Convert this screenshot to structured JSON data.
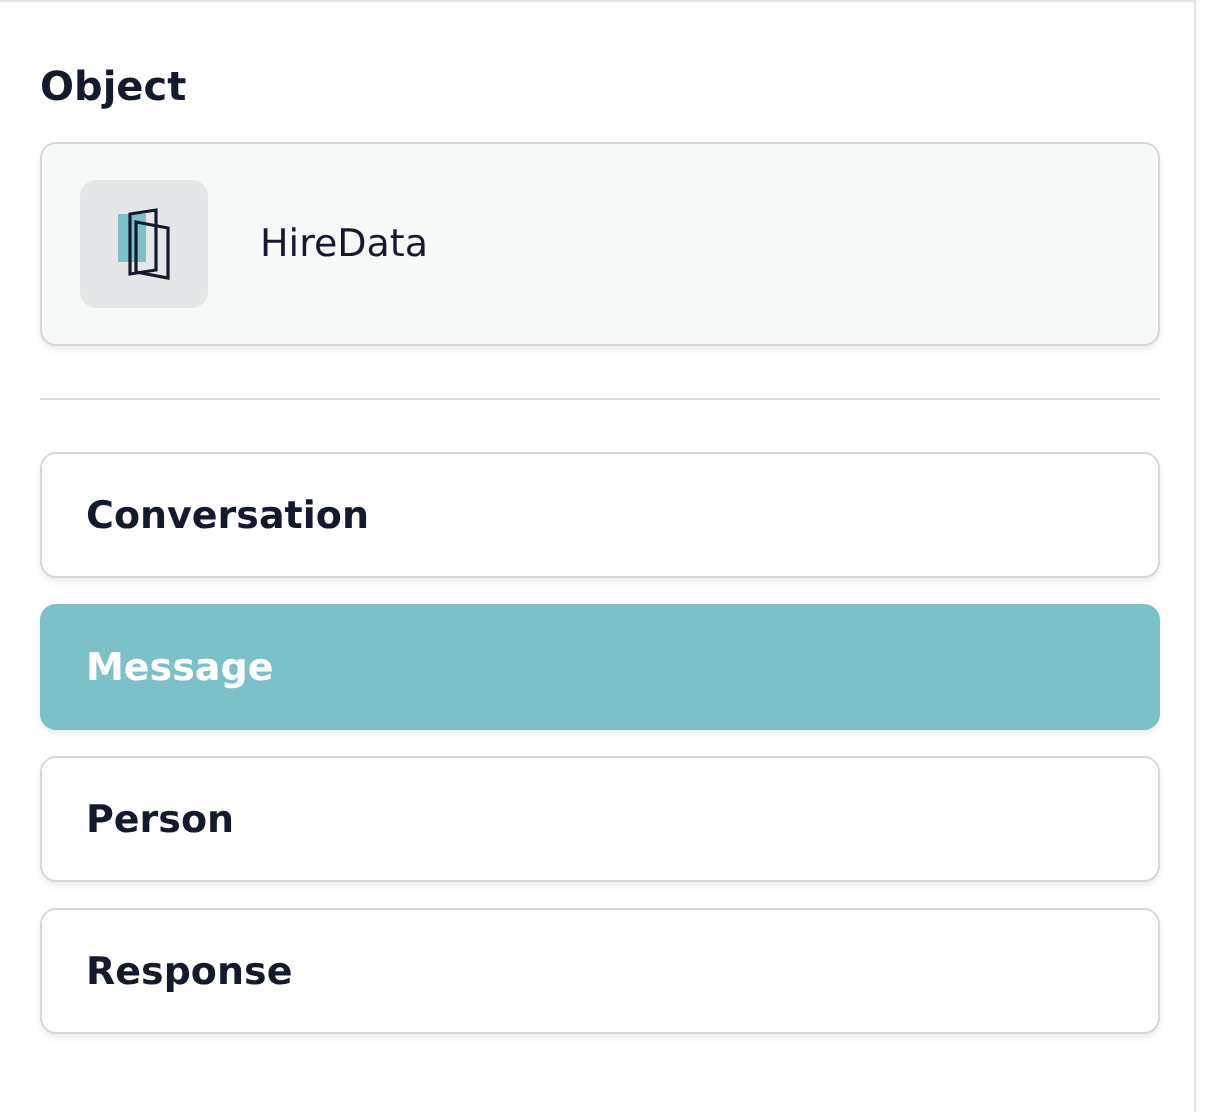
{
  "section": {
    "title": "Object"
  },
  "object_card": {
    "name": "HireData"
  },
  "items": [
    {
      "label": "Conversation",
      "selected": false
    },
    {
      "label": "Message",
      "selected": true
    },
    {
      "label": "Person",
      "selected": false
    },
    {
      "label": "Response",
      "selected": false
    }
  ]
}
